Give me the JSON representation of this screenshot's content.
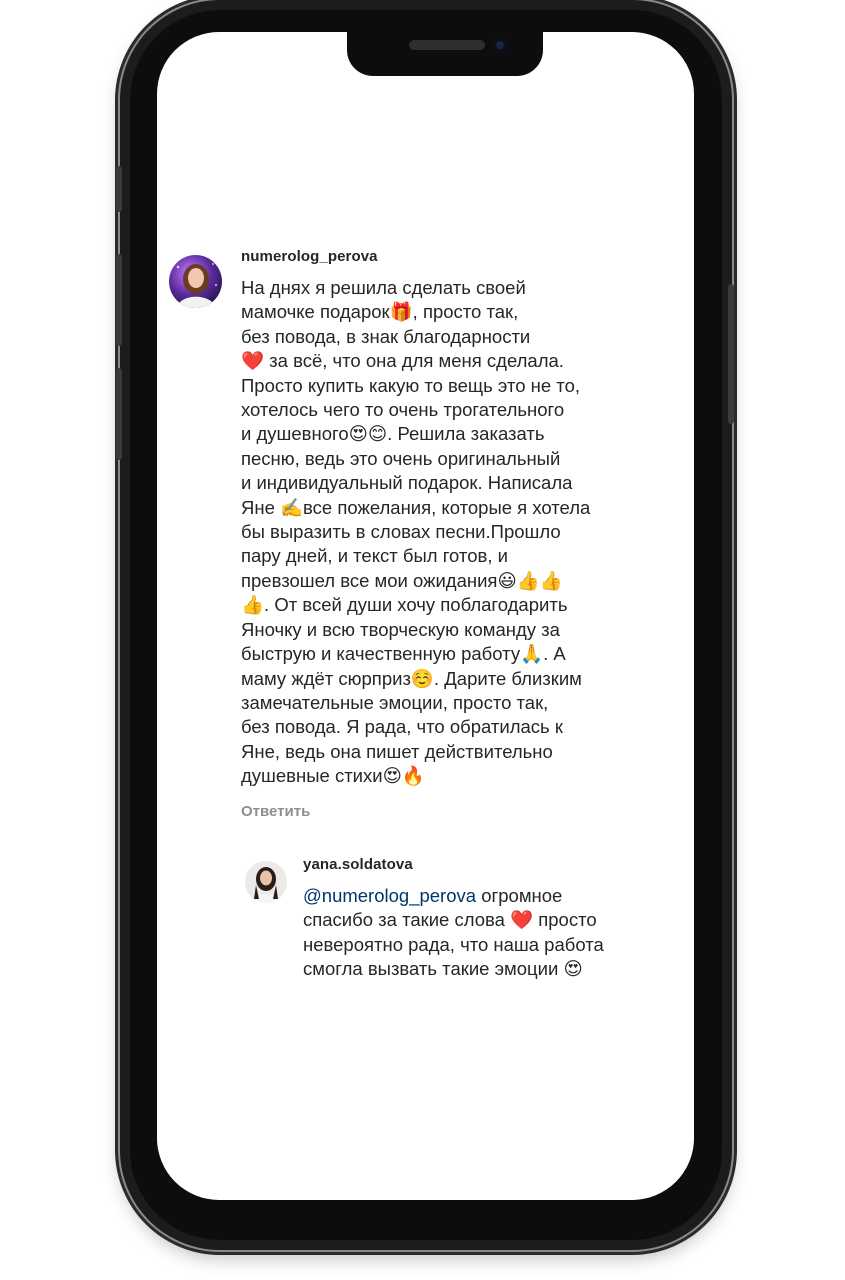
{
  "comment": {
    "username": "numerolog_perova",
    "avatar_icon": "profile-photo-icon",
    "lines": [
      "На днях я решила сделать своей",
      "мамочке подарок🎁, просто так,",
      "без повода, в знак благодарности",
      "❤️ за всё, что она для меня сделала.",
      "Просто купить какую то вещь это не то,",
      "хотелось чего то очень трогательного",
      "и душевного😍😊. Решила заказать",
      "песню, ведь это очень оригинальный",
      "и индивидуальный подарок. Написала",
      "Яне ✍️все пожелания, которые я хотела",
      "бы выразить в словах песни.Прошло",
      "пару дней, и текст был готов, и",
      "превзошел все мои ожидания😃👍👍",
      "👍. От всей души хочу поблагодарить",
      "Яночку и всю творческую команду за",
      "быструю и качественную работу🙏. А",
      "маму ждёт сюрприз☺️. Дарите близким",
      "замечательные эмоции, просто так,",
      "без повода. Я рада, что обратилась к",
      "Яне, ведь она пишет действительно",
      "душевные стихи😍🔥"
    ],
    "reply_label": "Ответить"
  },
  "reply": {
    "username": "yana.soldatova",
    "avatar_icon": "profile-photo-icon",
    "mention": "@numerolog_perova",
    "lines": [
      " огромное",
      "спасибо за такие слова ❤️ просто",
      "невероятно рада, что наша работа",
      "смогла вызвать такие эмоции 😍"
    ]
  }
}
